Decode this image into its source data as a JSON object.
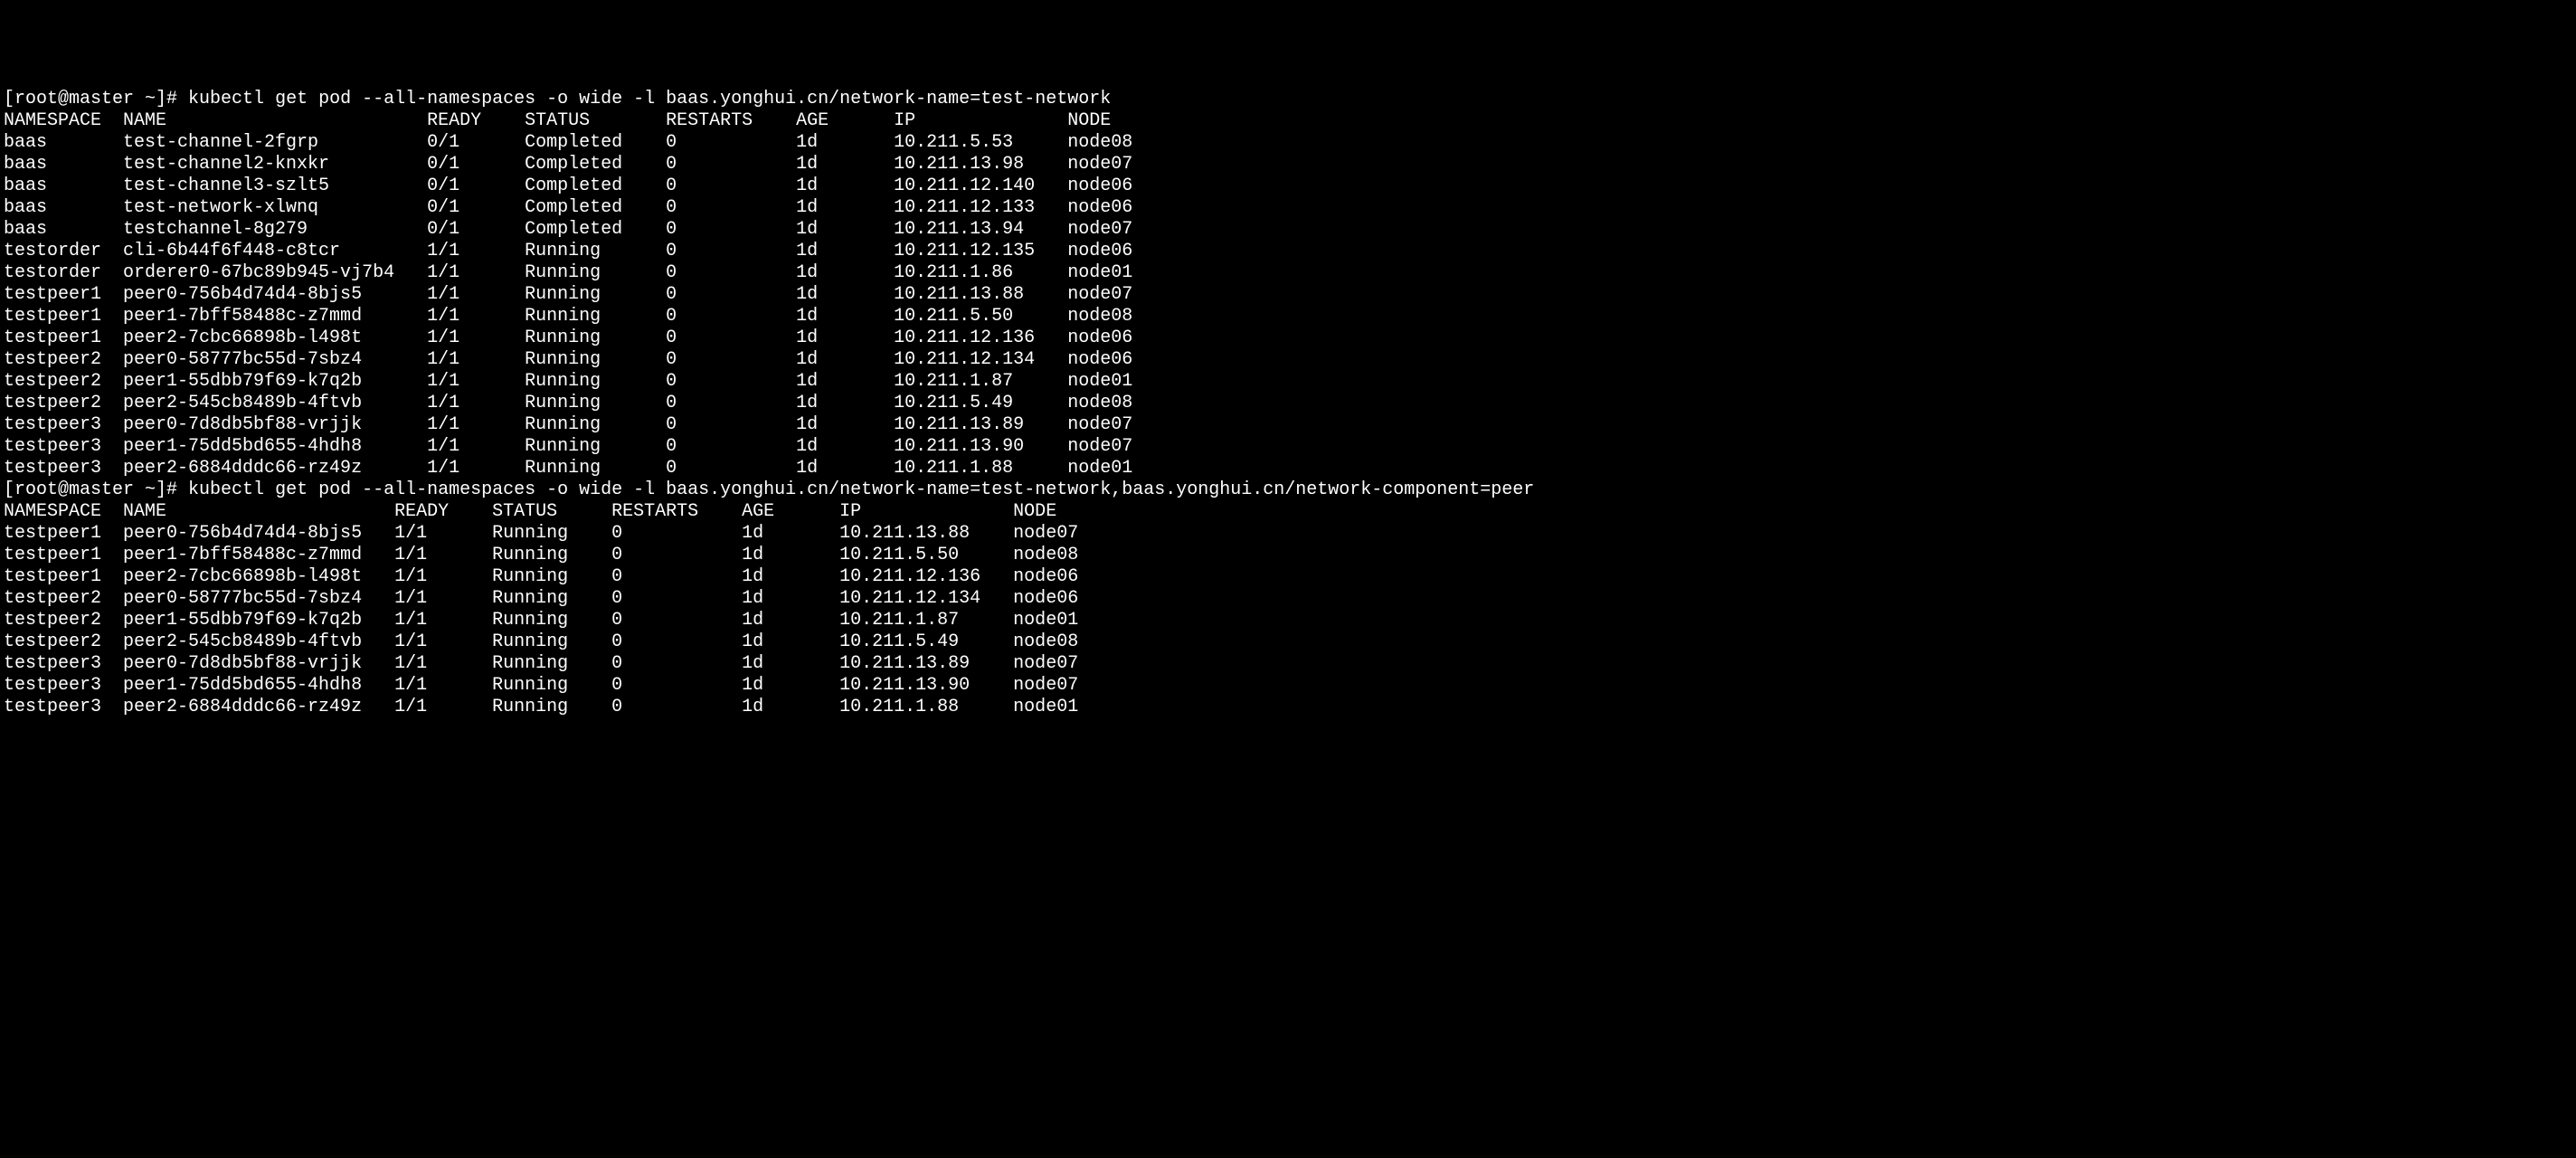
{
  "prompt1": {
    "user_host": "[root@master ~]#",
    "command": "kubectl get pod --all-namespaces -o wide -l baas.yonghui.cn/network-name=test-network"
  },
  "table1": {
    "headers": {
      "namespace": "NAMESPACE",
      "name": "NAME",
      "ready": "READY",
      "status": "STATUS",
      "restarts": "RESTARTS",
      "age": "AGE",
      "ip": "IP",
      "node": "NODE"
    },
    "rows": [
      {
        "namespace": "baas",
        "name": "test-channel-2fgrp",
        "ready": "0/1",
        "status": "Completed",
        "restarts": "0",
        "age": "1d",
        "ip": "10.211.5.53",
        "node": "node08"
      },
      {
        "namespace": "baas",
        "name": "test-channel2-knxkr",
        "ready": "0/1",
        "status": "Completed",
        "restarts": "0",
        "age": "1d",
        "ip": "10.211.13.98",
        "node": "node07"
      },
      {
        "namespace": "baas",
        "name": "test-channel3-szlt5",
        "ready": "0/1",
        "status": "Completed",
        "restarts": "0",
        "age": "1d",
        "ip": "10.211.12.140",
        "node": "node06"
      },
      {
        "namespace": "baas",
        "name": "test-network-xlwnq",
        "ready": "0/1",
        "status": "Completed",
        "restarts": "0",
        "age": "1d",
        "ip": "10.211.12.133",
        "node": "node06"
      },
      {
        "namespace": "baas",
        "name": "testchannel-8g279",
        "ready": "0/1",
        "status": "Completed",
        "restarts": "0",
        "age": "1d",
        "ip": "10.211.13.94",
        "node": "node07"
      },
      {
        "namespace": "testorder",
        "name": "cli-6b44f6f448-c8tcr",
        "ready": "1/1",
        "status": "Running",
        "restarts": "0",
        "age": "1d",
        "ip": "10.211.12.135",
        "node": "node06"
      },
      {
        "namespace": "testorder",
        "name": "orderer0-67bc89b945-vj7b4",
        "ready": "1/1",
        "status": "Running",
        "restarts": "0",
        "age": "1d",
        "ip": "10.211.1.86",
        "node": "node01"
      },
      {
        "namespace": "testpeer1",
        "name": "peer0-756b4d74d4-8bjs5",
        "ready": "1/1",
        "status": "Running",
        "restarts": "0",
        "age": "1d",
        "ip": "10.211.13.88",
        "node": "node07"
      },
      {
        "namespace": "testpeer1",
        "name": "peer1-7bff58488c-z7mmd",
        "ready": "1/1",
        "status": "Running",
        "restarts": "0",
        "age": "1d",
        "ip": "10.211.5.50",
        "node": "node08"
      },
      {
        "namespace": "testpeer1",
        "name": "peer2-7cbc66898b-l498t",
        "ready": "1/1",
        "status": "Running",
        "restarts": "0",
        "age": "1d",
        "ip": "10.211.12.136",
        "node": "node06"
      },
      {
        "namespace": "testpeer2",
        "name": "peer0-58777bc55d-7sbz4",
        "ready": "1/1",
        "status": "Running",
        "restarts": "0",
        "age": "1d",
        "ip": "10.211.12.134",
        "node": "node06"
      },
      {
        "namespace": "testpeer2",
        "name": "peer1-55dbb79f69-k7q2b",
        "ready": "1/1",
        "status": "Running",
        "restarts": "0",
        "age": "1d",
        "ip": "10.211.1.87",
        "node": "node01"
      },
      {
        "namespace": "testpeer2",
        "name": "peer2-545cb8489b-4ftvb",
        "ready": "1/1",
        "status": "Running",
        "restarts": "0",
        "age": "1d",
        "ip": "10.211.5.49",
        "node": "node08"
      },
      {
        "namespace": "testpeer3",
        "name": "peer0-7d8db5bf88-vrjjk",
        "ready": "1/1",
        "status": "Running",
        "restarts": "0",
        "age": "1d",
        "ip": "10.211.13.89",
        "node": "node07"
      },
      {
        "namespace": "testpeer3",
        "name": "peer1-75dd5bd655-4hdh8",
        "ready": "1/1",
        "status": "Running",
        "restarts": "0",
        "age": "1d",
        "ip": "10.211.13.90",
        "node": "node07"
      },
      {
        "namespace": "testpeer3",
        "name": "peer2-6884dddc66-rz49z",
        "ready": "1/1",
        "status": "Running",
        "restarts": "0",
        "age": "1d",
        "ip": "10.211.1.88",
        "node": "node01"
      }
    ],
    "col_widths": {
      "namespace": 11,
      "name": 28,
      "ready": 9,
      "status": 13,
      "restarts": 12,
      "age": 9,
      "ip": 16,
      "node": 6
    }
  },
  "prompt2": {
    "user_host": "[root@master ~]#",
    "command": "kubectl get pod --all-namespaces -o wide -l baas.yonghui.cn/network-name=test-network,baas.yonghui.cn/network-component=peer"
  },
  "table2": {
    "headers": {
      "namespace": "NAMESPACE",
      "name": "NAME",
      "ready": "READY",
      "status": "STATUS",
      "restarts": "RESTARTS",
      "age": "AGE",
      "ip": "IP",
      "node": "NODE"
    },
    "rows": [
      {
        "namespace": "testpeer1",
        "name": "peer0-756b4d74d4-8bjs5",
        "ready": "1/1",
        "status": "Running",
        "restarts": "0",
        "age": "1d",
        "ip": "10.211.13.88",
        "node": "node07"
      },
      {
        "namespace": "testpeer1",
        "name": "peer1-7bff58488c-z7mmd",
        "ready": "1/1",
        "status": "Running",
        "restarts": "0",
        "age": "1d",
        "ip": "10.211.5.50",
        "node": "node08"
      },
      {
        "namespace": "testpeer1",
        "name": "peer2-7cbc66898b-l498t",
        "ready": "1/1",
        "status": "Running",
        "restarts": "0",
        "age": "1d",
        "ip": "10.211.12.136",
        "node": "node06"
      },
      {
        "namespace": "testpeer2",
        "name": "peer0-58777bc55d-7sbz4",
        "ready": "1/1",
        "status": "Running",
        "restarts": "0",
        "age": "1d",
        "ip": "10.211.12.134",
        "node": "node06"
      },
      {
        "namespace": "testpeer2",
        "name": "peer1-55dbb79f69-k7q2b",
        "ready": "1/1",
        "status": "Running",
        "restarts": "0",
        "age": "1d",
        "ip": "10.211.1.87",
        "node": "node01"
      },
      {
        "namespace": "testpeer2",
        "name": "peer2-545cb8489b-4ftvb",
        "ready": "1/1",
        "status": "Running",
        "restarts": "0",
        "age": "1d",
        "ip": "10.211.5.49",
        "node": "node08"
      },
      {
        "namespace": "testpeer3",
        "name": "peer0-7d8db5bf88-vrjjk",
        "ready": "1/1",
        "status": "Running",
        "restarts": "0",
        "age": "1d",
        "ip": "10.211.13.89",
        "node": "node07"
      },
      {
        "namespace": "testpeer3",
        "name": "peer1-75dd5bd655-4hdh8",
        "ready": "1/1",
        "status": "Running",
        "restarts": "0",
        "age": "1d",
        "ip": "10.211.13.90",
        "node": "node07"
      },
      {
        "namespace": "testpeer3",
        "name": "peer2-6884dddc66-rz49z",
        "ready": "1/1",
        "status": "Running",
        "restarts": "0",
        "age": "1d",
        "ip": "10.211.1.88",
        "node": "node01"
      }
    ],
    "col_widths": {
      "namespace": 11,
      "name": 25,
      "ready": 9,
      "status": 11,
      "restarts": 12,
      "age": 9,
      "ip": 16,
      "node": 6
    }
  }
}
